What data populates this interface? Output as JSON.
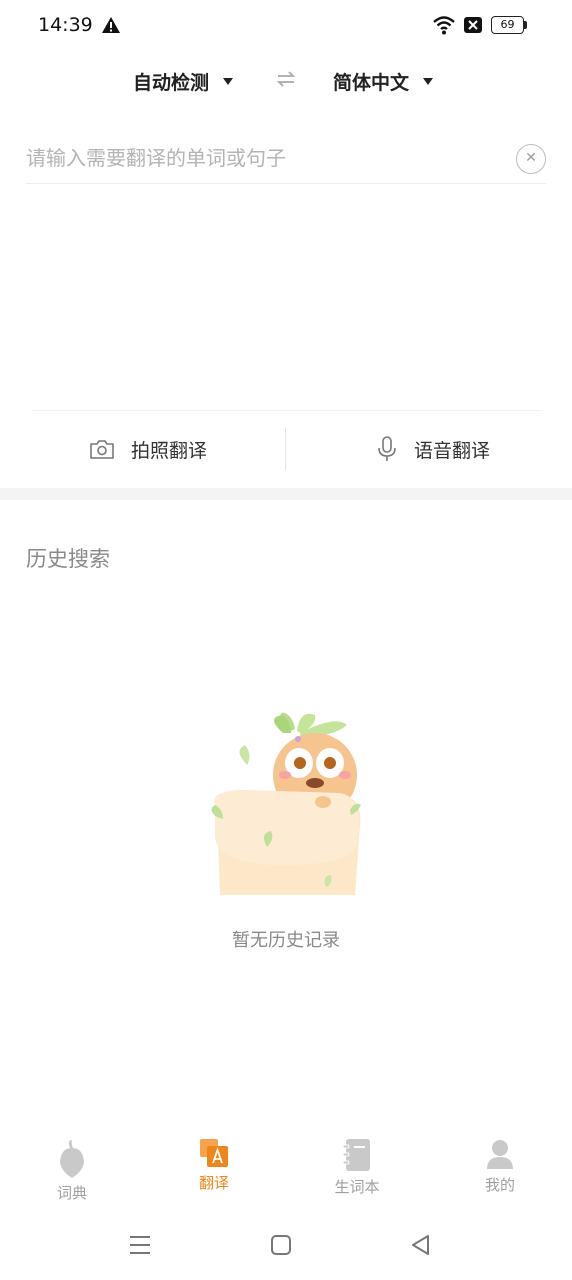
{
  "status": {
    "time": "14:39",
    "battery": "69"
  },
  "lang": {
    "source": "自动检测",
    "target": "简体中文"
  },
  "input": {
    "placeholder": "请输入需要翻译的单词或句子",
    "value": ""
  },
  "actions": {
    "photo": "拍照翻译",
    "voice": "语音翻译"
  },
  "history": {
    "title": "历史搜索",
    "empty": "暂无历史记录"
  },
  "nav": {
    "items": [
      {
        "label": "词典",
        "icon": "dictionary-icon"
      },
      {
        "label": "翻译",
        "icon": "translate-icon"
      },
      {
        "label": "生词本",
        "icon": "wordbook-icon"
      },
      {
        "label": "我的",
        "icon": "profile-icon"
      }
    ],
    "active_index": 1
  },
  "colors": {
    "accent": "#f0861b",
    "muted": "#a0a0a0"
  }
}
